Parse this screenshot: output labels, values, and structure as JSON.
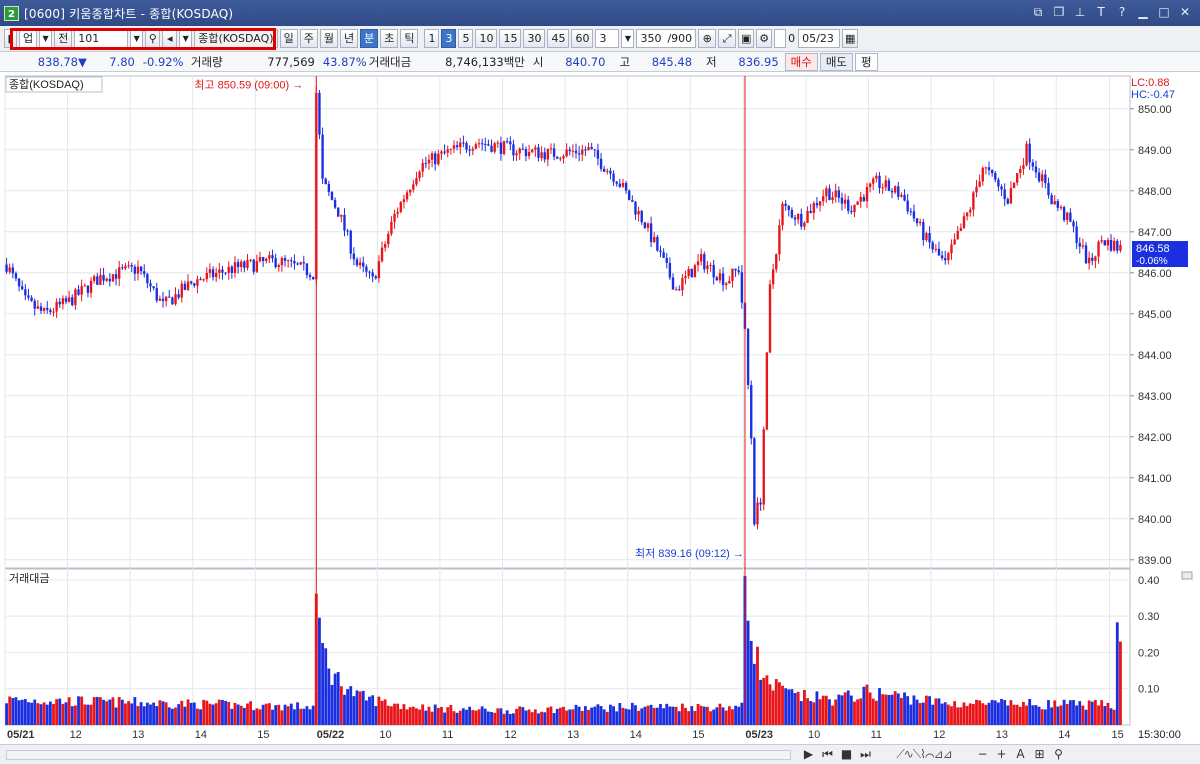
{
  "window": {
    "title": "[0600] 키움종합차트 - 종합(KOSDAQ)",
    "app_number": "2"
  },
  "toolbar": {
    "market_type": "업",
    "prefix": "전",
    "code": "101",
    "name": "종합(KOSDAQ)",
    "periods": [
      "일",
      "주",
      "월",
      "년",
      "분",
      "초",
      "틱"
    ],
    "period_selected": "분",
    "minute_options": [
      "1",
      "3",
      "5",
      "10",
      "15",
      "30",
      "45",
      "60"
    ],
    "minute_selected": "3",
    "interval_value": "3",
    "count_value": "350",
    "count_max": "/900",
    "checkbox_label": "0",
    "date_value": "05/23"
  },
  "quote": {
    "price": "838.78",
    "direction": "▼",
    "change": "7.80",
    "change_pct": "-0.92%",
    "volume_label": "거래량",
    "volume_value": "777,569",
    "volume_pct": "43.87%",
    "amount_label": "거래대금",
    "amount_value": "8,746,133백만",
    "open_label": "시",
    "open_value": "840.70",
    "high_label": "고",
    "high_value": "845.48",
    "low_label": "저",
    "low_value": "836.95",
    "buy_label": "매수",
    "sell_label": "매도",
    "avg_label": "평"
  },
  "chart_data": [
    {
      "type": "candlestick",
      "title": "종합(KOSDAQ)",
      "ylim": [
        838.8,
        850.8
      ],
      "y_ticks": [
        "850.00",
        "849.00",
        "848.00",
        "847.00",
        "846.00",
        "845.00",
        "844.00",
        "843.00",
        "842.00",
        "841.00",
        "840.00",
        "839.00"
      ],
      "x_tick_labels": [
        {
          "label": "05/21",
          "bold": true
        },
        {
          "label": "12"
        },
        {
          "label": "13"
        },
        {
          "label": "14"
        },
        {
          "label": "15"
        },
        {
          "label": "05/22",
          "bold": true
        },
        {
          "label": "10"
        },
        {
          "label": "11"
        },
        {
          "label": "12"
        },
        {
          "label": "13"
        },
        {
          "label": "14"
        },
        {
          "label": "15"
        },
        {
          "label": "05/23",
          "bold": true
        },
        {
          "label": "10"
        },
        {
          "label": "11"
        },
        {
          "label": "12"
        },
        {
          "label": "13"
        },
        {
          "label": "14"
        },
        {
          "label": "15"
        }
      ],
      "corner_info": {
        "lc": "LC:0.88",
        "hc": "HC:-0.47"
      },
      "annotations": [
        {
          "text": "최고 850.59 (09:00)",
          "value": 850.59,
          "kind": "high"
        },
        {
          "text": "최저 839.16 (09:12)",
          "value": 839.16,
          "kind": "low"
        }
      ],
      "last_price_tag": {
        "value": "846.58",
        "pct": "-0.06%"
      },
      "price_anchors": [
        [
          0,
          846.2
        ],
        [
          6,
          845.3
        ],
        [
          12,
          845.0
        ],
        [
          20,
          845.3
        ],
        [
          30,
          845.9
        ],
        [
          42,
          846.1
        ],
        [
          50,
          845.2
        ],
        [
          60,
          845.8
        ],
        [
          72,
          846.1
        ],
        [
          86,
          846.3
        ],
        [
          98,
          846.0
        ],
        [
          99,
          850.4
        ],
        [
          101,
          848.2
        ],
        [
          106,
          847.5
        ],
        [
          112,
          846.2
        ],
        [
          117,
          845.8
        ],
        [
          124,
          847.4
        ],
        [
          132,
          848.6
        ],
        [
          140,
          848.9
        ],
        [
          150,
          849.2
        ],
        [
          162,
          849.0
        ],
        [
          174,
          848.9
        ],
        [
          186,
          849.0
        ],
        [
          195,
          848.3
        ],
        [
          204,
          847.2
        ],
        [
          214,
          845.6
        ],
        [
          222,
          846.3
        ],
        [
          230,
          845.8
        ],
        [
          234,
          846.1
        ],
        [
          236,
          844.5
        ],
        [
          238,
          842.0
        ],
        [
          239,
          840.0
        ],
        [
          241,
          840.5
        ],
        [
          244,
          845.6
        ],
        [
          248,
          847.6
        ],
        [
          254,
          847.3
        ],
        [
          262,
          848.0
        ],
        [
          270,
          847.6
        ],
        [
          278,
          848.2
        ],
        [
          286,
          847.9
        ],
        [
          294,
          846.8
        ],
        [
          300,
          846.2
        ],
        [
          308,
          847.6
        ],
        [
          312,
          848.6
        ],
        [
          320,
          847.8
        ],
        [
          326,
          849.0
        ],
        [
          334,
          847.8
        ],
        [
          340,
          847.2
        ],
        [
          346,
          846.2
        ],
        [
          350,
          846.8
        ],
        [
          356,
          846.6
        ]
      ]
    },
    {
      "type": "bar",
      "title": "거래대금",
      "ylim": [
        0,
        0.43
      ],
      "y_ticks": [
        "0.40",
        "0.30",
        "0.20",
        "0.10"
      ],
      "time_label": "15:30:00",
      "volume_anchors": [
        [
          0,
          0.07
        ],
        [
          98,
          0.05
        ],
        [
          99,
          0.36
        ],
        [
          100,
          0.24
        ],
        [
          104,
          0.14
        ],
        [
          112,
          0.08
        ],
        [
          125,
          0.055
        ],
        [
          140,
          0.045
        ],
        [
          160,
          0.04
        ],
        [
          200,
          0.05
        ],
        [
          235,
          0.05
        ],
        [
          236,
          0.41
        ],
        [
          238,
          0.25
        ],
        [
          242,
          0.12
        ],
        [
          252,
          0.08
        ],
        [
          265,
          0.07
        ],
        [
          275,
          0.09
        ],
        [
          285,
          0.08
        ],
        [
          300,
          0.06
        ],
        [
          354,
          0.055
        ],
        [
          355,
          0.26
        ]
      ]
    }
  ],
  "statusbar": {
    "time_label": "15:30:00",
    "nav_icons": [
      "play-next-icon",
      "rewind-icon",
      "stop-icon",
      "fast-forward-icon"
    ],
    "tool_icons": [
      "minus-icon",
      "plus-icon",
      "font-icon",
      "magnifier-icon"
    ]
  }
}
